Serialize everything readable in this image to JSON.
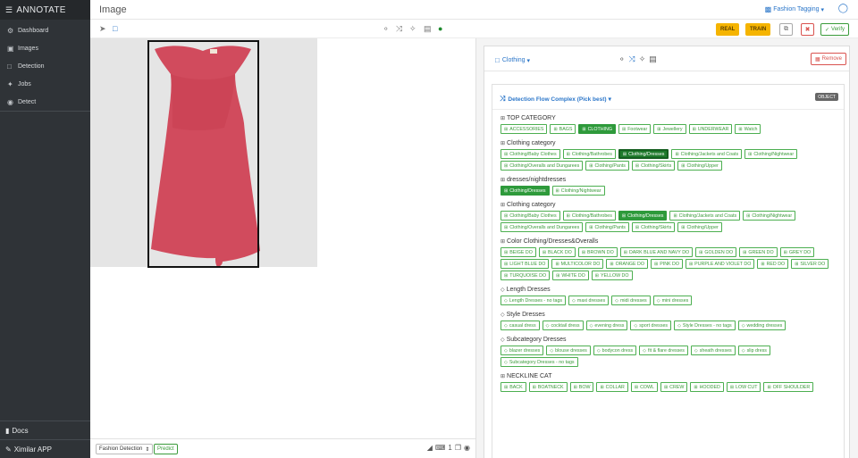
{
  "sidebar": {
    "brand": "ANNOTATE",
    "items": [
      {
        "icon": "dashboard-icon",
        "label": "Dashboard"
      },
      {
        "icon": "images-icon",
        "label": "Images"
      },
      {
        "icon": "detection-icon",
        "label": "Detection"
      },
      {
        "icon": "jobs-icon",
        "label": "Jobs"
      },
      {
        "icon": "detect-icon",
        "label": "Detect"
      }
    ],
    "docs": "Docs",
    "app": "Ximilar APP"
  },
  "topbar": {
    "title": "Image",
    "project": "Fashion Tagging"
  },
  "toolbar": {
    "real": "REAL",
    "train": "TRAIN",
    "verify": "Verify"
  },
  "canvas": {
    "model": "Fashion Detection",
    "predict": "Predict",
    "count": "1"
  },
  "object": {
    "category": "Clothing",
    "remove": "Remove",
    "flow_title": "Detection Flow Complex (Pick best)",
    "badge": "OBJECT"
  },
  "groups": [
    {
      "title": "TOP CATEGORY",
      "icon": "task",
      "chips": [
        {
          "label": "ACCESSORIES"
        },
        {
          "label": "BAGS"
        },
        {
          "label": "CLOTHING",
          "state": "sel"
        },
        {
          "label": "Footwear"
        },
        {
          "label": "Jewellery"
        },
        {
          "label": "UNDERWEAR"
        },
        {
          "label": "Watch"
        }
      ]
    },
    {
      "title": "Clothing category",
      "icon": "task",
      "chips": [
        {
          "label": "Clothing/Baby Clothes"
        },
        {
          "label": "Clothing/Bathrobes"
        },
        {
          "label": "Clothing/Dresses",
          "state": "sel-dark"
        },
        {
          "label": "Clothing/Jackets and Coats"
        },
        {
          "label": "Clothing/Nightwear"
        },
        {
          "label": "Clothing/Overalls and Dungarees"
        },
        {
          "label": "Clothing/Pants"
        },
        {
          "label": "Clothing/Skirts"
        },
        {
          "label": "Clothing/Upper"
        }
      ]
    },
    {
      "title": "dresses/nightdresses",
      "icon": "task",
      "chips": [
        {
          "label": "Clothing/Dresses",
          "state": "sel"
        },
        {
          "label": "Clothing/Nightwear"
        }
      ]
    },
    {
      "title": "Clothing category",
      "icon": "task",
      "chips": [
        {
          "label": "Clothing/Baby Clothes"
        },
        {
          "label": "Clothing/Bathrobes"
        },
        {
          "label": "Clothing/Dresses",
          "state": "sel"
        },
        {
          "label": "Clothing/Jackets and Coats"
        },
        {
          "label": "Clothing/Nightwear"
        },
        {
          "label": "Clothing/Overalls and Dungarees"
        },
        {
          "label": "Clothing/Pants"
        },
        {
          "label": "Clothing/Skirts"
        },
        {
          "label": "Clothing/Upper"
        }
      ]
    },
    {
      "title": "Color Clothing/Dresses&Overalls",
      "icon": "task",
      "chips": [
        {
          "label": "BEIGE DO"
        },
        {
          "label": "BLACK DO"
        },
        {
          "label": "BROWN DO"
        },
        {
          "label": "DARK BLUE AND NAVY DO"
        },
        {
          "label": "GOLDEN DO"
        },
        {
          "label": "GREEN DO"
        },
        {
          "label": "GREY DO"
        },
        {
          "label": "LIGHT BLUE DO"
        },
        {
          "label": "MULTICOLOR DO"
        },
        {
          "label": "ORANGE DO"
        },
        {
          "label": "PINK DO"
        },
        {
          "label": "PURPLE AND VIOLET DO"
        },
        {
          "label": "RED DO"
        },
        {
          "label": "SILVER DO"
        },
        {
          "label": "TURQUOISE DO"
        },
        {
          "label": "WHITE DO"
        },
        {
          "label": "YELLOW DO"
        }
      ]
    },
    {
      "title": "Length Dresses",
      "icon": "tag",
      "chips": [
        {
          "label": "Length Dresses - no tags"
        },
        {
          "label": "maxi dresses"
        },
        {
          "label": "midi dresses"
        },
        {
          "label": "mini dresses"
        }
      ]
    },
    {
      "title": "Style Dresses",
      "icon": "tag",
      "chips": [
        {
          "label": "casual dress"
        },
        {
          "label": "cocktail dress"
        },
        {
          "label": "evening dress"
        },
        {
          "label": "sport dresses"
        },
        {
          "label": "Style Dresses - no tags"
        },
        {
          "label": "wedding dresses"
        }
      ]
    },
    {
      "title": "Subcategory Dresses",
      "icon": "tag",
      "chips": [
        {
          "label": "blazer dresses"
        },
        {
          "label": "blouse dresses"
        },
        {
          "label": "bodycon dress"
        },
        {
          "label": "fit & flare dresses"
        },
        {
          "label": "sheath dresses"
        },
        {
          "label": "slip dress"
        },
        {
          "label": "Subcategory Dresses - no tags"
        }
      ]
    },
    {
      "title": "NECKLINE CAT",
      "icon": "task",
      "chips": [
        {
          "label": "BACK"
        },
        {
          "label": "BOATNECK"
        },
        {
          "label": "BOW"
        },
        {
          "label": "COLLAR"
        },
        {
          "label": "COWL"
        },
        {
          "label": "CREW"
        },
        {
          "label": "HOODED"
        },
        {
          "label": "LOW CUT"
        },
        {
          "label": "OFF SHOULDER"
        }
      ]
    }
  ]
}
